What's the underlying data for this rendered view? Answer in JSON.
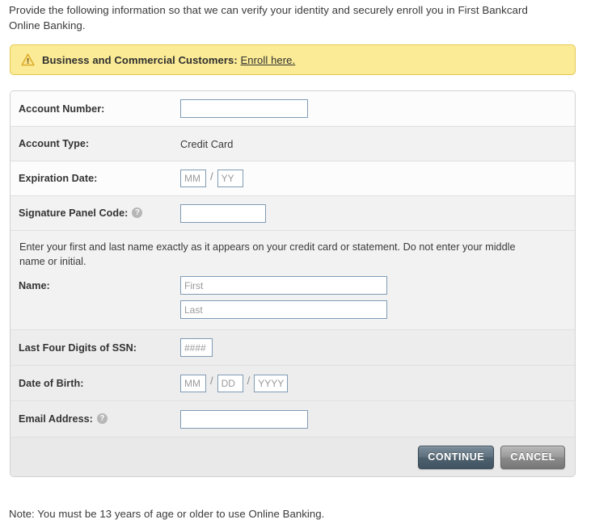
{
  "intro": {
    "text": "Provide the following information so that we can verify your identity and securely enroll you in First Bankcard Online Banking."
  },
  "alert": {
    "icon": "warning-triangle-icon",
    "label": "Business and Commercial Customers:",
    "link_text": "Enroll here.",
    "background_color": "#fbeb96",
    "border_color": "#e3c84e"
  },
  "form": {
    "account_number": {
      "label": "Account Number:",
      "value": "",
      "placeholder": ""
    },
    "account_type": {
      "label": "Account Type:",
      "value": "Credit Card"
    },
    "expiration_date": {
      "label": "Expiration Date:",
      "month_placeholder": "MM",
      "year_placeholder": "YY",
      "separator": "/",
      "month_value": "",
      "year_value": ""
    },
    "signature_panel_code": {
      "label": "Signature Panel Code:",
      "help_icon": "help-question-icon",
      "value": "",
      "placeholder": ""
    },
    "name_section": {
      "note": "Enter your first and last name exactly as it appears on your credit card or statement. Do not enter your middle name or initial.",
      "label": "Name:",
      "first_placeholder": "First",
      "last_placeholder": "Last",
      "first_value": "",
      "last_value": ""
    },
    "ssn": {
      "label": "Last Four Digits of SSN:",
      "placeholder": "####",
      "value": ""
    },
    "date_of_birth": {
      "label": "Date of Birth:",
      "month_placeholder": "MM",
      "day_placeholder": "DD",
      "year_placeholder": "YYYY",
      "separator": "/",
      "month_value": "",
      "day_value": "",
      "year_value": ""
    },
    "email": {
      "label": "Email Address:",
      "help_icon": "help-question-icon",
      "value": "",
      "placeholder": ""
    }
  },
  "buttons": {
    "continue": "CONTINUE",
    "cancel": "CANCEL",
    "continue_color": "#5e707e",
    "cancel_color": "#9a9a9a"
  },
  "footer": {
    "note": "Note: You must be 13 years of age or older to use Online Banking."
  }
}
